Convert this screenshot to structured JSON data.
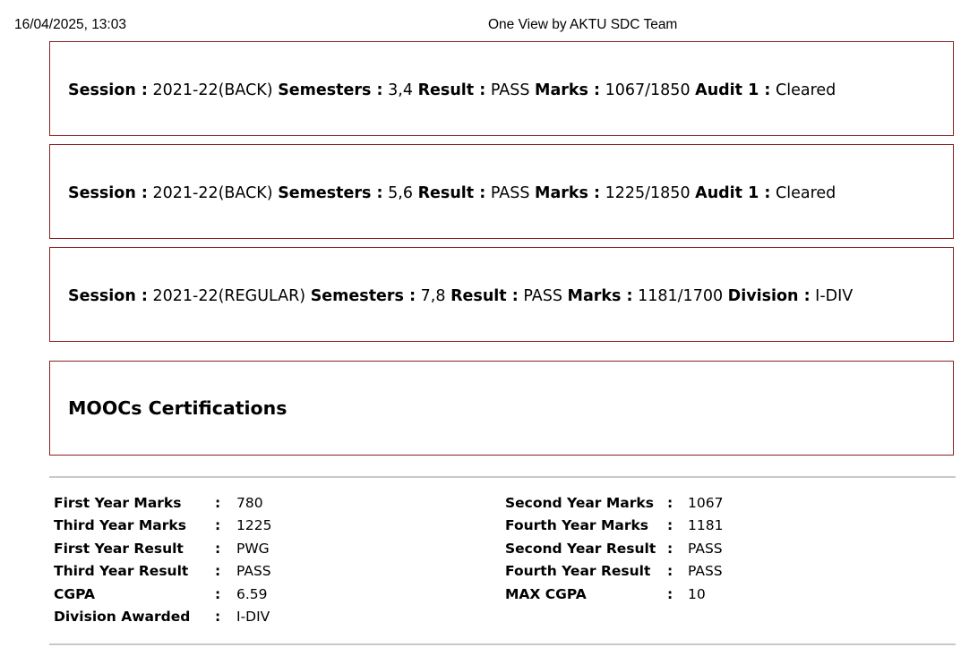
{
  "header": {
    "datetime": "16/04/2025, 13:03",
    "title": "One View by AKTU SDC Team"
  },
  "sessions": [
    {
      "session_label": "Session :",
      "session": "2021-22(BACK)",
      "semesters_label": "Semesters :",
      "semesters": "3,4",
      "result_label": "Result :",
      "result": "PASS",
      "marks_label": "Marks :",
      "marks": "1067/1850",
      "extra_label": "Audit 1 :",
      "extra": "Cleared"
    },
    {
      "session_label": "Session :",
      "session": "2021-22(BACK)",
      "semesters_label": "Semesters :",
      "semesters": "5,6",
      "result_label": "Result :",
      "result": "PASS",
      "marks_label": "Marks :",
      "marks": "1225/1850",
      "extra_label": "Audit 1 :",
      "extra": "Cleared"
    },
    {
      "session_label": "Session :",
      "session": "2021-22(REGULAR)",
      "semesters_label": "Semesters :",
      "semesters": "7,8",
      "result_label": "Result :",
      "result": "PASS",
      "marks_label": "Marks :",
      "marks": "1181/1700",
      "extra_label": "Division :",
      "extra": "I-DIV"
    }
  ],
  "moocs": {
    "title": "MOOCs Certifications"
  },
  "summary": {
    "left": [
      {
        "label": "First Year Marks",
        "value": "780"
      },
      {
        "label": "Third Year Marks",
        "value": "1225"
      },
      {
        "label": "First Year Result",
        "value": "PWG"
      },
      {
        "label": "Third Year Result",
        "value": "PASS"
      },
      {
        "label": "CGPA",
        "value": "6.59"
      },
      {
        "label": "Division Awarded",
        "value": "I-DIV"
      }
    ],
    "right": [
      {
        "label": "Second Year Marks",
        "value": "1067"
      },
      {
        "label": "Fourth Year Marks",
        "value": "1181"
      },
      {
        "label": "Second Year Result",
        "value": "PASS"
      },
      {
        "label": "Fourth Year Result",
        "value": "PASS"
      },
      {
        "label": "MAX CGPA",
        "value": "10"
      }
    ],
    "separator": ":"
  }
}
